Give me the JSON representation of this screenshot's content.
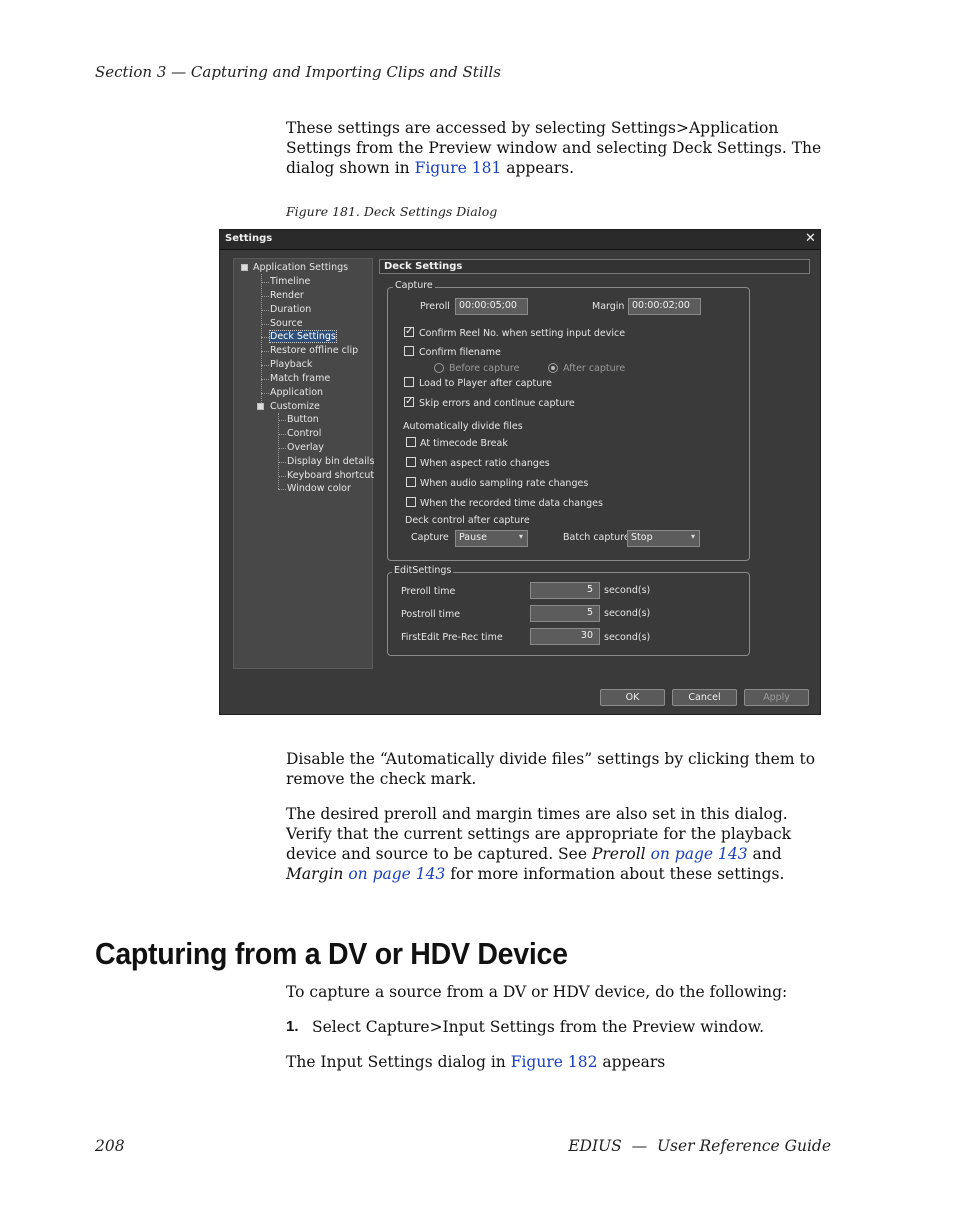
{
  "page": {
    "header": "Section 3 — Capturing and Importing Clips and Stills",
    "intro": {
      "part1": "These settings are accessed by selecting Settings>Application Settings from the Preview window and selecting Deck Settings. The dialog shown in",
      "link": "Figure 181",
      "part2": "appears."
    },
    "figure_caption": "Figure 181.  Deck Settings Dialog",
    "para_disable": "Disable the “Automatically divide files” settings by clicking them to remove the check mark.",
    "para_preroll": {
      "text1": "The desired preroll and margin times are also set in this dialog. Verify that the current settings are appropriate for the playback device and source to be captured. See",
      "em1": "Preroll",
      "link1": "on page 143",
      "and": "and",
      "em2": "Margin",
      "link2": "on page 143",
      "text2": "for more information about these settings."
    },
    "heading": "Capturing from a DV or HDV Device",
    "para_capture": "To capture a source from a DV or HDV device, do the following:",
    "step1": {
      "num": "1.",
      "text": "Select Capture>Input Settings from the Preview window."
    },
    "para_input": {
      "text1": "The Input Settings dialog in",
      "link": "Figure 182",
      "text2": "appears"
    },
    "footer_page": "208",
    "footer_title": "EDIUS  —  User Reference Guide"
  },
  "dialog": {
    "title": "Settings",
    "close_glyph": "✕",
    "tree": {
      "root": "Application Settings",
      "items": [
        "Timeline",
        "Render",
        "Duration",
        "Source",
        "Deck Settings",
        "Restore offline clip",
        "Playback",
        "Match frame",
        "Application",
        "Customize"
      ],
      "customize_children": [
        "Button",
        "Control",
        "Overlay",
        "Display bin details",
        "Keyboard shortcut",
        "Window color"
      ]
    },
    "panel_title": "Deck Settings",
    "capture_group": {
      "label": "Capture",
      "preroll_label": "Preroll",
      "preroll_value": "00:00:05;00",
      "margin_label": "Margin",
      "margin_value": "00:00:02;00",
      "confirm_reel": "Confirm Reel No. when setting input device",
      "confirm_filename": "Confirm filename",
      "before_capture": "Before capture",
      "after_capture": "After capture",
      "load_player": "Load to Player after capture",
      "skip_errors": "Skip errors and continue capture",
      "auto_divide_label": "Automatically divide files",
      "at_timecode": "At timecode Break",
      "aspect_ratio": "When aspect ratio changes",
      "audio_sampling": "When audio sampling rate changes",
      "recorded_time": "When the recorded time data changes",
      "deck_control_label": "Deck control after capture",
      "capture_label": "Capture",
      "capture_value": "Pause",
      "batch_label": "Batch capture",
      "batch_value": "Stop",
      "check_glyph": "✓"
    },
    "edit_group": {
      "label": "EditSettings",
      "preroll_time_label": "Preroll time",
      "preroll_time_value": "5",
      "postroll_time_label": "Postroll time",
      "postroll_time_value": "5",
      "firstedit_label": "FirstEdit Pre-Rec time",
      "firstedit_value": "30",
      "unit": "second(s)"
    },
    "buttons": {
      "ok": "OK",
      "cancel": "Cancel",
      "apply": "Apply"
    },
    "dropdown_glyph": "▾"
  }
}
